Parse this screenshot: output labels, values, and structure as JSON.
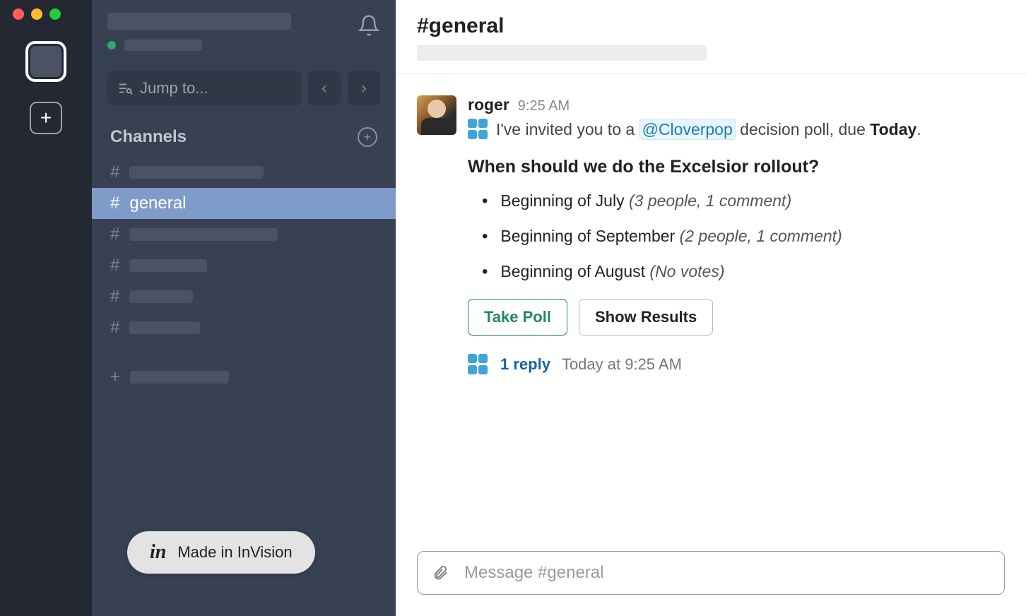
{
  "sidebar": {
    "jump_placeholder": "Jump to...",
    "channels_heading": "Channels",
    "active_channel": "general"
  },
  "header": {
    "channel_name": "#general"
  },
  "message": {
    "username": "roger",
    "timestamp": "9:25 AM",
    "invite_prefix": "I've invited you to a",
    "mention": "@Cloverpop",
    "invite_mid": "decision poll, due",
    "due": "Today",
    "invite_suffix": ".",
    "poll_question": "When should we do the Excelsior rollout?",
    "options": [
      {
        "label": "Beginning of July",
        "meta": "(3 people, 1 comment)"
      },
      {
        "label": "Beginning of September",
        "meta": "(2 people, 1 comment)"
      },
      {
        "label": "Beginning of August",
        "meta": "(No votes)"
      }
    ],
    "take_poll_label": "Take Poll",
    "show_results_label": "Show Results",
    "reply_count": "1 reply",
    "reply_time": "Today at 9:25 AM"
  },
  "composer": {
    "placeholder": "Message #general"
  },
  "badge": {
    "text": "Made in InVision"
  }
}
